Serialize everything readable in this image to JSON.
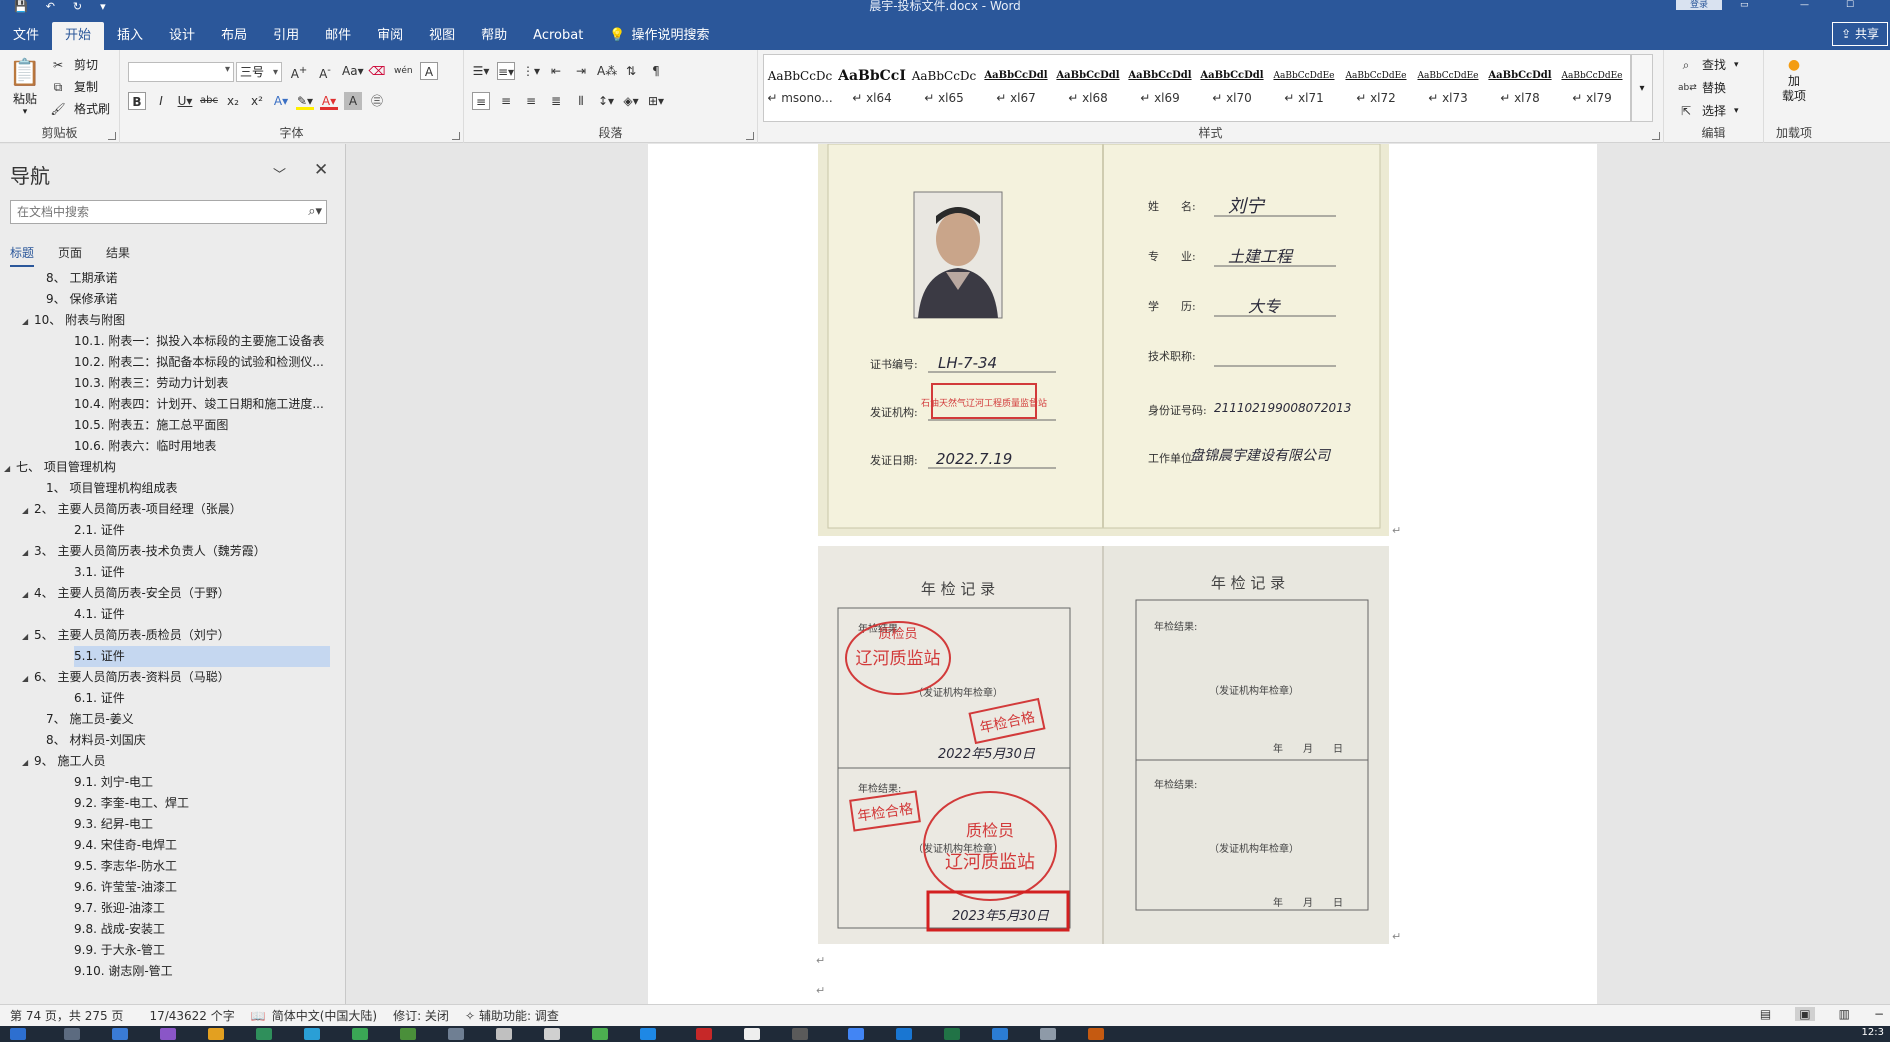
{
  "window": {
    "doc_title": "晨宇-投标文件.docx  -  Word",
    "login": "登录",
    "share": "共享"
  },
  "tabs": [
    "文件",
    "开始",
    "插入",
    "设计",
    "布局",
    "引用",
    "邮件",
    "审阅",
    "视图",
    "帮助",
    "Acrobat"
  ],
  "tell_me": "操作说明搜索",
  "clipboard": {
    "paste": "粘贴",
    "cut": "剪切",
    "copy": "复制",
    "format_painter": "格式刷",
    "label": "剪贴板"
  },
  "font": {
    "name_value": "",
    "size_value": "三号",
    "label": "字体"
  },
  "paragraph": {
    "label": "段落"
  },
  "styles": {
    "label": "样式",
    "items": [
      {
        "sample": "AaBbCcDc",
        "name": "↵ msono..."
      },
      {
        "sample": "AaBbCcI",
        "name": "↵ xl64"
      },
      {
        "sample": "AaBbCcDc",
        "name": "↵ xl65"
      },
      {
        "sample": "AaBbCcDdl",
        "name": "↵ xl67"
      },
      {
        "sample": "AaBbCcDdl",
        "name": "↵ xl68"
      },
      {
        "sample": "AaBbCcDdl",
        "name": "↵ xl69"
      },
      {
        "sample": "AaBbCcDdl",
        "name": "↵ xl70"
      },
      {
        "sample": "AaBbCcDdEe",
        "name": "↵ xl71"
      },
      {
        "sample": "AaBbCcDdEe",
        "name": "↵ xl72"
      },
      {
        "sample": "AaBbCcDdEe",
        "name": "↵ xl73"
      },
      {
        "sample": "AaBbCcDdl",
        "name": "↵ xl78"
      },
      {
        "sample": "AaBbCcDdEe",
        "name": "↵ xl79"
      }
    ]
  },
  "editing": {
    "find": "查找",
    "replace": "替换",
    "select": "选择",
    "label": "编辑"
  },
  "addins": {
    "load": "加\n载项",
    "label": "加载项"
  },
  "nav": {
    "title": "导航",
    "search_placeholder": "在文档中搜索",
    "tabs": [
      "标题",
      "页面",
      "结果"
    ],
    "items": [
      {
        "text": "8、 工期承诺",
        "level": 2,
        "expand": false
      },
      {
        "text": "9、 保修承诺",
        "level": 2,
        "expand": false
      },
      {
        "text": "10、 附表与附图",
        "level": 2,
        "expand": true
      },
      {
        "text": "10.1. 附表一：拟投入本标段的主要施工设备表",
        "level": 3,
        "expand": false
      },
      {
        "text": "10.2. 附表二：拟配备本标段的试验和检测仪...",
        "level": 3,
        "expand": false
      },
      {
        "text": "10.3. 附表三：劳动力计划表",
        "level": 3,
        "expand": false
      },
      {
        "text": "10.4. 附表四：计划开、竣工日期和施工进度...",
        "level": 3,
        "expand": false
      },
      {
        "text": "10.5. 附表五：施工总平面图",
        "level": 3,
        "expand": false
      },
      {
        "text": "10.6. 附表六：临时用地表",
        "level": 3,
        "expand": false
      },
      {
        "text": "七、 项目管理机构",
        "level": 1,
        "expand": true
      },
      {
        "text": "1、 项目管理机构组成表",
        "level": 2,
        "expand": false
      },
      {
        "text": "2、 主要人员简历表-项目经理（张晨）",
        "level": 2,
        "expand": true
      },
      {
        "text": "2.1. 证件",
        "level": 3,
        "expand": false
      },
      {
        "text": "3、 主要人员简历表-技术负责人（魏芳霞）",
        "level": 2,
        "expand": true
      },
      {
        "text": "3.1. 证件",
        "level": 3,
        "expand": false
      },
      {
        "text": "4、 主要人员简历表-安全员（于野）",
        "level": 2,
        "expand": true
      },
      {
        "text": "4.1. 证件",
        "level": 3,
        "expand": false
      },
      {
        "text": "5、 主要人员简历表-质检员（刘宁）",
        "level": 2,
        "expand": true
      },
      {
        "text": "5.1. 证件",
        "level": 3,
        "expand": false,
        "selected": true
      },
      {
        "text": "6、 主要人员简历表-资料员（马聪）",
        "level": 2,
        "expand": true
      },
      {
        "text": "6.1. 证件",
        "level": 3,
        "expand": false
      },
      {
        "text": "7、 施工员-姜义",
        "level": 2,
        "expand": false
      },
      {
        "text": "8、 材料员-刘国庆",
        "level": 2,
        "expand": false
      },
      {
        "text": "9、 施工人员",
        "level": 2,
        "expand": true
      },
      {
        "text": "9.1. 刘宁-电工",
        "level": 3,
        "expand": false
      },
      {
        "text": "9.2. 李奎-电工、焊工",
        "level": 3,
        "expand": false
      },
      {
        "text": "9.3. 纪昇-电工",
        "level": 3,
        "expand": false
      },
      {
        "text": "9.4. 宋佳奇-电焊工",
        "level": 3,
        "expand": false
      },
      {
        "text": "9.5. 李志华-防水工",
        "level": 3,
        "expand": false
      },
      {
        "text": "9.6. 许莹莹-油漆工",
        "level": 3,
        "expand": false
      },
      {
        "text": "9.7. 张迎-油漆工",
        "level": 3,
        "expand": false
      },
      {
        "text": "9.8. 战成-安装工",
        "level": 3,
        "expand": false
      },
      {
        "text": "9.9. 于大永-管工",
        "level": 3,
        "expand": false
      },
      {
        "text": "9.10. 谢志刚-管工",
        "level": 3,
        "expand": false
      }
    ]
  },
  "cert_top": {
    "labels": {
      "name": "姓　　名:",
      "major": "专　　业:",
      "education": "学　　历:",
      "title": "技术职称:",
      "id_no": "身份证号码:",
      "work_unit": "工作单位",
      "cert_no": "证书编号:",
      "issuer": "发证机构:",
      "issue_date": "发证日期:"
    },
    "values": {
      "name": "刘宁",
      "major": "土建工程",
      "education": "大专",
      "id_no": "211102199008072013",
      "work_unit": "盘锦晨宇建设有限公司",
      "cert_no": "LH-7-34",
      "issuer_stamp": "石油天然气辽河工程质量监督站",
      "issue_date": "2022.7.19"
    }
  },
  "cert_bottom": {
    "left_title": "年 检 记 录",
    "right_title": "年 检 记 录",
    "result_label": "年检结果:",
    "issuer_stamp_note": "（发证机构年检章）",
    "ymd": "年　　月　　日",
    "stamp_texts": {
      "zjy": "质检员",
      "lhzjz": "辽河质监站",
      "pass": "年检合格",
      "pass2": "年检合格"
    },
    "date1": "2022年5月30日",
    "date2": "2023年5月30日"
  },
  "status": {
    "page": "第 74 页，共 275 页",
    "words": "17/43622 个字",
    "lang": "简体中文(中国大陆)",
    "track": "修订: 关闭",
    "accessibility": "辅助功能: 调查"
  },
  "clock": "12:3",
  "colors": {
    "accent": "#2b579a",
    "selected": "#c5d7f0",
    "stamp_red": "#d23a3a",
    "highlight_box": "#d32020"
  }
}
